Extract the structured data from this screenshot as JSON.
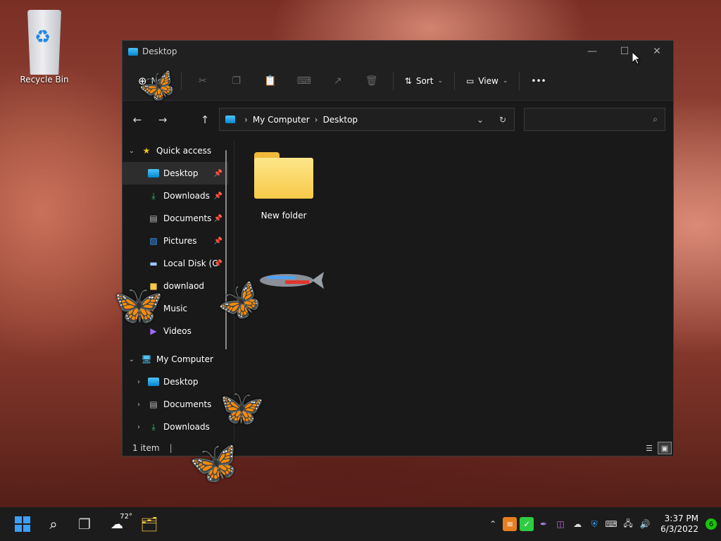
{
  "desktop": {
    "recycle_bin_label": "Recycle Bin"
  },
  "window": {
    "title": "Desktop",
    "toolbar": {
      "new_label": "New",
      "sort_label": "Sort",
      "view_label": "View",
      "more_label": "•••"
    },
    "address": {
      "root": "My Computer",
      "current": "Desktop"
    },
    "search": {
      "placeholder": ""
    },
    "sidebar": {
      "quick_access": "Quick access",
      "items": [
        {
          "label": "Desktop"
        },
        {
          "label": "Downloads"
        },
        {
          "label": "Documents"
        },
        {
          "label": "Pictures"
        },
        {
          "label": "Local Disk (C"
        },
        {
          "label": "downlaod"
        },
        {
          "label": "Music"
        },
        {
          "label": "Videos"
        }
      ],
      "my_computer": "My Computer",
      "pc_items": [
        {
          "label": "Desktop"
        },
        {
          "label": "Documents"
        },
        {
          "label": "Downloads"
        }
      ]
    },
    "content": {
      "items": [
        {
          "label": "New folder"
        }
      ]
    },
    "status": {
      "count": "1 item"
    }
  },
  "taskbar": {
    "weather_temp": "72°",
    "time": "3:37 PM",
    "date": "6/3/2022",
    "notification_count": "6"
  },
  "colors": {
    "accent": "#0078d4",
    "folder": "#f7c948",
    "butterfly": "#ff7a1a"
  }
}
